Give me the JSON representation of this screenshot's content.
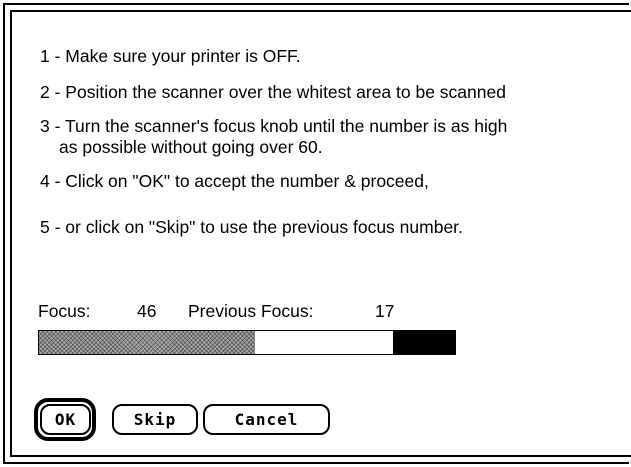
{
  "instructions": {
    "step1": "1 - Make sure your printer is OFF.",
    "step2": "2 - Position the scanner over the whitest area to be scanned",
    "step3": "3 - Turn the scanner's focus knob until the number is as high",
    "step3_cont": "as possible without going over 60.",
    "step4": "4 - Click on \"OK\" to accept the number & proceed,",
    "step5": "5 - or click on \"Skip\" to use the previous focus number."
  },
  "focus": {
    "label": "Focus:",
    "value": "46",
    "previous_label": "Previous Focus:",
    "previous_value": "17",
    "bar_max": 60,
    "bar_level": 46,
    "bar_fill_fraction": 0.52,
    "bar_black_fraction": 0.15
  },
  "buttons": {
    "ok": "OK",
    "skip": "Skip",
    "cancel": "Cancel"
  },
  "colors": {
    "fill_pattern": "#a9a9a9",
    "limit_zone": "#000000",
    "frame": "#000000"
  }
}
